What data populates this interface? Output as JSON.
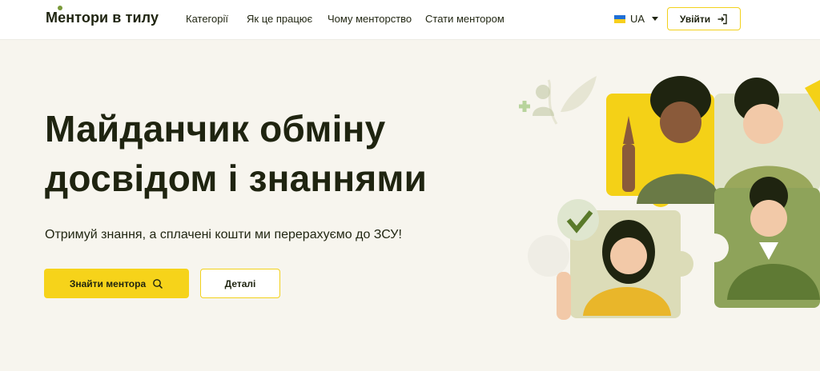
{
  "header": {
    "logo": "Ментори в тилу",
    "nav": [
      "Категорії",
      "Як це працює",
      "Чому менторство",
      "Стати ментором"
    ],
    "language": "UA",
    "login_label": "Увійти"
  },
  "hero": {
    "title_line1": "Майданчик обміну",
    "title_line2": "досвідом і знаннями",
    "subtitle": "Отримуй знання, а сплачені кошти ми перерахуємо до ЗСУ!",
    "primary_button": "Знайти ментора",
    "secondary_button": "Деталі"
  },
  "colors": {
    "accent": "#f6d31a",
    "text": "#1f2410",
    "background": "#f7f5ee",
    "green": "#7a9a3a"
  },
  "icons": [
    "search-icon",
    "login-icon",
    "chevron-down-icon",
    "ukraine-flag-icon"
  ]
}
